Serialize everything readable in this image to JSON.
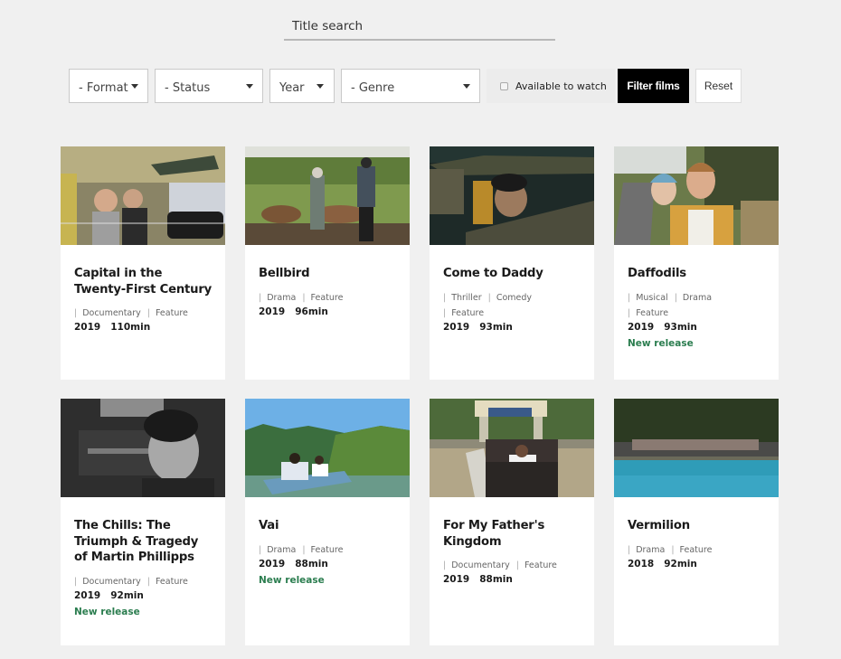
{
  "search": {
    "placeholder": "Title search"
  },
  "filters": {
    "format": "- Format",
    "status": "- Status",
    "year": "Year",
    "genre": "- Genre",
    "available_label": "Available to watch",
    "available_checked": false,
    "filter_button": "Filter films",
    "reset_button": "Reset"
  },
  "colors": {
    "new_release": "#2b7d4f",
    "filter_button_bg": "#000000",
    "page_bg": "#f0f0f0"
  },
  "films": [
    {
      "title": "Capital in the Twenty-First Century",
      "tags": [
        "Documentary",
        "Feature"
      ],
      "year": "2019",
      "duration": "110min",
      "badge": "",
      "image": "collage-icon"
    },
    {
      "title": "Bellbird",
      "tags": [
        "Drama",
        "Feature"
      ],
      "year": "2019",
      "duration": "96min",
      "badge": "",
      "image": "farm-cattle-icon"
    },
    {
      "title": "Come to Daddy",
      "tags": [
        "Thriller",
        "Comedy",
        "Feature"
      ],
      "year": "2019",
      "duration": "93min",
      "badge": "",
      "image": "man-in-car-icon"
    },
    {
      "title": "Daffodils",
      "tags": [
        "Musical",
        "Drama",
        "Feature"
      ],
      "year": "2019",
      "duration": "93min",
      "badge": "New release",
      "image": "couple-bike-icon"
    },
    {
      "title": "The Chills: The Triumph & Tragedy of Martin Phillipps",
      "tags": [
        "Documentary",
        "Feature"
      ],
      "year": "2019",
      "duration": "92min",
      "badge": "New release",
      "image": "bw-portrait-icon"
    },
    {
      "title": "Vai",
      "tags": [
        "Drama",
        "Feature"
      ],
      "year": "2019",
      "duration": "88min",
      "badge": "New release",
      "image": "canoe-icon"
    },
    {
      "title": "For My Father's Kingdom",
      "tags": [
        "Documentary",
        "Feature"
      ],
      "year": "2019",
      "duration": "88min",
      "badge": "",
      "image": "group-gate-icon"
    },
    {
      "title": "Vermilion",
      "tags": [
        "Drama",
        "Feature"
      ],
      "year": "2018",
      "duration": "92min",
      "badge": "",
      "image": "pool-icon"
    }
  ]
}
